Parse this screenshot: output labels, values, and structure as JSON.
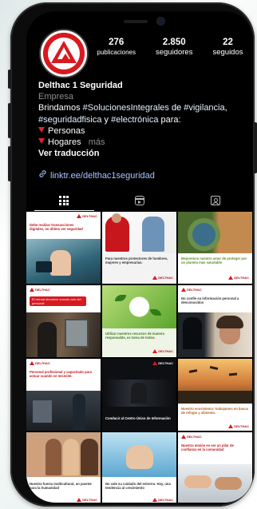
{
  "profile": {
    "stats": [
      {
        "num": "276",
        "label": "publicaciones"
      },
      {
        "num": "2.850",
        "label": "seguidores"
      },
      {
        "num": "22",
        "label": "seguidos"
      }
    ],
    "name": "Delthac 1 Seguridad",
    "category": "Empresa",
    "bio_line1_a": "Brindamos ",
    "bio_tag1": "#SolucionesIntegrales",
    "bio_line1_b": " de ",
    "bio_tag2": "#vigilancia",
    "bio_line1_c": ",",
    "bio_tag3": "#seguridadfisica",
    "bio_line2_a": " y ",
    "bio_tag4": "#electrónica",
    "bio_line2_b": " para:",
    "bullet1": "Personas",
    "bullet2": "Hogares",
    "more": "más",
    "translate": "Ver traducción",
    "link": "linktr.ee/delthac1seguridad"
  },
  "tabs": [
    "grid-icon",
    "reels-icon",
    "tagged-icon"
  ],
  "posts": [
    {
      "caption": "Debe realizar transacciones digitales, no último ver seguridad",
      "theme": "light"
    },
    {
      "caption": "Para nuestros protectores de hombres, mujeres y empresarias.",
      "theme": "red"
    },
    {
      "caption": "Mejoremos nuestro amor de proteger por un planeta más saludable",
      "theme": "earth"
    },
    {
      "caption": "El retroal devuelve cuando aún del personal",
      "theme": "atm"
    },
    {
      "caption": "Utilizar nuestros recursos de manera responsable, es tarea de todos.",
      "theme": "green"
    },
    {
      "caption": "No confíe su información personal a desconocidos",
      "theme": "phone"
    },
    {
      "caption": "Personal profesional y capacitado para actuar cuando se necesite.",
      "theme": "guard"
    },
    {
      "caption": "Conducir al Centro Único de Información",
      "theme": "dark"
    },
    {
      "caption": "Nuestro ecosistema: trabajamos en busca de refugio y alimento.",
      "theme": "birds"
    },
    {
      "caption": "Nuestra fuerza multicultural, un puente para la humanidad",
      "theme": "people"
    },
    {
      "caption": "No vale su cuidado del entorno. Hoy, una tendencia al crecimiento",
      "theme": "water"
    },
    {
      "caption": "Nuestra misión es ser un pilar de confianza en la comunidad",
      "theme": "hands"
    }
  ],
  "brand": {
    "red": "#d8191f",
    "logo_text": "DELTHAC"
  }
}
